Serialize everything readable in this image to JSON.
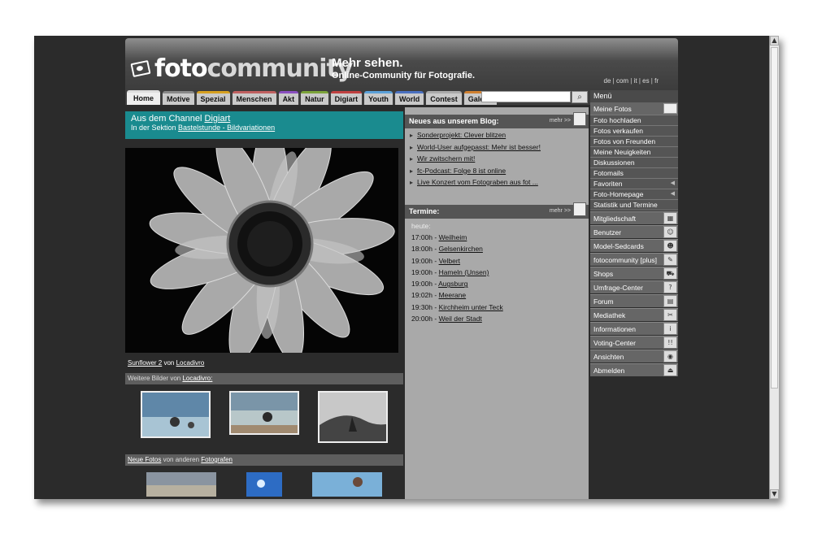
{
  "header": {
    "logo_text_a": "foto",
    "logo_text_b": "community",
    "slogan_a": "Mehr sehen.",
    "slogan_b": "Online-Community für Fotografie.",
    "langs": [
      "de",
      "com",
      "it",
      "es",
      "fr"
    ]
  },
  "tabs": [
    "Home",
    "Motive",
    "Spezial",
    "Menschen",
    "Akt",
    "Natur",
    "Digiart",
    "Youth",
    "World",
    "Contest",
    "Galerie"
  ],
  "tab_colors": [
    "#dddddd",
    "#888888",
    "#d6a020",
    "#c06060",
    "#8a4fc0",
    "#7ba33a",
    "#c04040",
    "#5aa0d8",
    "#4a70c0",
    "#aaaaaa",
    "#d08030"
  ],
  "search": {
    "placeholder": "",
    "button_icon": "search-icon"
  },
  "channel": {
    "line1_prefix": "Aus dem Channel ",
    "line1_link": "Digiart",
    "line2_prefix": "In der Sektion ",
    "line2_link": "Bastelstunde - Bildvariationen"
  },
  "photo": {
    "title": "Sunflower 2",
    "by": " von ",
    "author": "Locadivro"
  },
  "more_from": {
    "prefix": "Weitere Bilder von ",
    "author": "Locadivro:"
  },
  "new_photos": {
    "link": "Neue Fotos",
    "middle": " von anderen ",
    "link2": "Fotografen"
  },
  "blog": {
    "title": "Neues aus unserem Blog:",
    "more": "mehr >>",
    "items": [
      "Sonderprojekt: Clever blitzen",
      "World-User aufgepasst: Mehr ist besser!",
      "Wir zwitschern mit!",
      "fc-Podcast: Folge 8 ist online",
      "Live Konzert vom Fotograben aus fot ..."
    ]
  },
  "termine": {
    "title": "Termine:",
    "more": "mehr >>",
    "today": "heute:",
    "items": [
      {
        "time": "17:00h - ",
        "place": "Weilheim"
      },
      {
        "time": "18:00h - ",
        "place": "Gelsenkirchen"
      },
      {
        "time": "19:00h - ",
        "place": "Velbert"
      },
      {
        "time": "19:00h - ",
        "place": "Hameln (Unsen)"
      },
      {
        "time": "19:00h - ",
        "place": "Augsburg"
      },
      {
        "time": "19:02h - ",
        "place": "Meerane"
      },
      {
        "time": "19:30h - ",
        "place": "Kirchheim unter Teck"
      },
      {
        "time": "20:00h - ",
        "place": "Weil der Stadt"
      }
    ]
  },
  "menu": {
    "title": "Menü",
    "meine_fotos": "Meine Fotos",
    "sub": [
      "Foto hochladen",
      "Fotos verkaufen",
      "Fotos von Freunden",
      "Meine Neuigkeiten",
      "Diskussionen",
      "Fotomails",
      "Favoriten",
      "Foto-Homepage",
      "Statistik und Termine"
    ],
    "sections": [
      "Mitgliedschaft",
      "Benutzer",
      "Model-Sedcards",
      "fotocommunity [plus]",
      "Shops",
      "Umfrage-Center",
      "Forum",
      "Mediathek",
      "Informationen",
      "Voting-Center",
      "Ansichten",
      "Abmelden"
    ],
    "section_icons": [
      "▦",
      "☺",
      "☻",
      "✎",
      "⛟",
      "?",
      "▤",
      "✂",
      "i",
      "!!",
      "◉",
      "⏏"
    ]
  }
}
